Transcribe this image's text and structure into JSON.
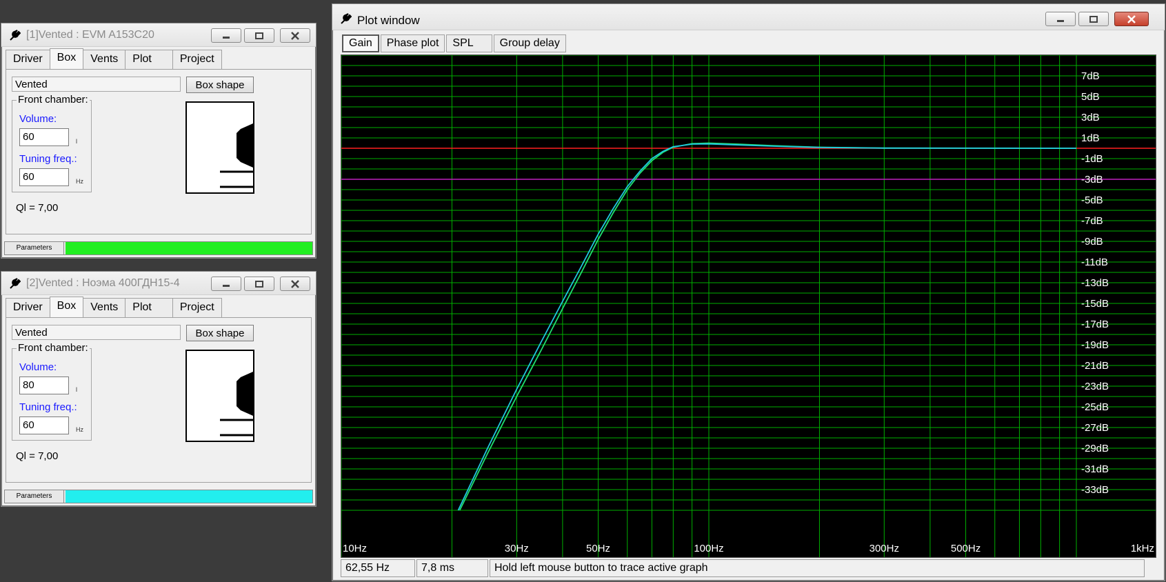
{
  "windows": [
    {
      "title": "[1]Vented : EVM A153C20",
      "tabs": [
        "Driver",
        "Box",
        "Vents",
        "Plot",
        "Project"
      ],
      "selected_tab": "Box",
      "box_type": "Vented",
      "box_shape_button": "Box shape",
      "front_chamber_label": "Front chamber:",
      "volume_label": "Volume:",
      "volume_value": "60",
      "volume_unit": "l",
      "tuning_label": "Tuning freq.:",
      "tuning_value": "60",
      "tuning_unit": "Hz",
      "ql": "Ql = 7,00",
      "status_label": "Parameters",
      "status_color": "#22ee22"
    },
    {
      "title": "[2]Vented : Ноэма 400ГДН15-4",
      "tabs": [
        "Driver",
        "Box",
        "Vents",
        "Plot",
        "Project"
      ],
      "selected_tab": "Box",
      "box_type": "Vented",
      "box_shape_button": "Box shape",
      "front_chamber_label": "Front chamber:",
      "volume_label": "Volume:",
      "volume_value": "80",
      "volume_unit": "l",
      "tuning_label": "Tuning freq.:",
      "tuning_value": "60",
      "tuning_unit": "Hz",
      "ql": "Ql = 7,00",
      "status_label": "Parameters",
      "status_color": "#22eeee"
    }
  ],
  "plot_window": {
    "title": "Plot window",
    "tabs": [
      "Gain",
      "Phase plot",
      "SPL",
      "Group delay"
    ],
    "selected_tab": "Gain",
    "status": {
      "frequency": "62,55 Hz",
      "time": "7,8 ms",
      "hint": "Hold left mouse button to trace active graph"
    }
  },
  "chart_data": {
    "type": "line",
    "x_scale": "log",
    "xlim": [
      10,
      1000
    ],
    "ylim": [
      -35,
      9
    ],
    "x_tick_labels": [
      {
        "value": 10,
        "label": "10Hz"
      },
      {
        "value": 30,
        "label": "30Hz"
      },
      {
        "value": 50,
        "label": "50Hz"
      },
      {
        "value": 100,
        "label": "100Hz"
      },
      {
        "value": 300,
        "label": "300Hz"
      },
      {
        "value": 500,
        "label": "500Hz"
      },
      {
        "value": 1000,
        "label": "1kHz"
      }
    ],
    "y_tick_labels": [
      {
        "value": 7,
        "label": "7dB"
      },
      {
        "value": 5,
        "label": "5dB"
      },
      {
        "value": 3,
        "label": "3dB"
      },
      {
        "value": 1,
        "label": "1dB"
      },
      {
        "value": -1,
        "label": "-1dB"
      },
      {
        "value": -3,
        "label": "-3dB"
      },
      {
        "value": -5,
        "label": "-5dB"
      },
      {
        "value": -7,
        "label": "-7dB"
      },
      {
        "value": -9,
        "label": "-9dB"
      },
      {
        "value": -11,
        "label": "-11dB"
      },
      {
        "value": -13,
        "label": "-13dB"
      },
      {
        "value": -15,
        "label": "-15dB"
      },
      {
        "value": -17,
        "label": "-17dB"
      },
      {
        "value": -19,
        "label": "-19dB"
      },
      {
        "value": -21,
        "label": "-21dB"
      },
      {
        "value": -23,
        "label": "-23dB"
      },
      {
        "value": -25,
        "label": "-25dB"
      },
      {
        "value": -27,
        "label": "-27dB"
      },
      {
        "value": -29,
        "label": "-29dB"
      },
      {
        "value": -31,
        "label": "-31dB"
      },
      {
        "value": -33,
        "label": "-33dB"
      }
    ],
    "reference_lines": [
      {
        "y": 0,
        "color": "#ff2020"
      },
      {
        "y": -3,
        "color": "#c020c0"
      }
    ],
    "grid": true,
    "grid_color": "#00b000",
    "series": [
      {
        "color": "#20e070",
        "points": [
          [
            21,
            -35
          ],
          [
            25,
            -29.5
          ],
          [
            30,
            -24
          ],
          [
            35,
            -19.5
          ],
          [
            40,
            -15.5
          ],
          [
            45,
            -12
          ],
          [
            50,
            -8.8
          ],
          [
            55,
            -6.2
          ],
          [
            60,
            -4
          ],
          [
            65,
            -2.4
          ],
          [
            70,
            -1.2
          ],
          [
            75,
            -0.4
          ],
          [
            80,
            0.1
          ],
          [
            90,
            0.45
          ],
          [
            100,
            0.5
          ],
          [
            120,
            0.4
          ],
          [
            150,
            0.25
          ],
          [
            200,
            0.1
          ],
          [
            300,
            0.02
          ],
          [
            1000,
            0
          ]
        ]
      },
      {
        "color": "#20c8e0",
        "points": [
          [
            20.8,
            -35
          ],
          [
            25,
            -29
          ],
          [
            30,
            -23.3
          ],
          [
            35,
            -18.7
          ],
          [
            40,
            -14.8
          ],
          [
            45,
            -11.4
          ],
          [
            50,
            -8.3
          ],
          [
            55,
            -5.8
          ],
          [
            60,
            -3.7
          ],
          [
            65,
            -2.2
          ],
          [
            70,
            -1.0
          ],
          [
            75,
            -0.3
          ],
          [
            80,
            0.15
          ],
          [
            90,
            0.4
          ],
          [
            100,
            0.42
          ],
          [
            120,
            0.32
          ],
          [
            150,
            0.2
          ],
          [
            200,
            0.08
          ],
          [
            300,
            0.01
          ],
          [
            1000,
            0
          ]
        ]
      }
    ]
  }
}
